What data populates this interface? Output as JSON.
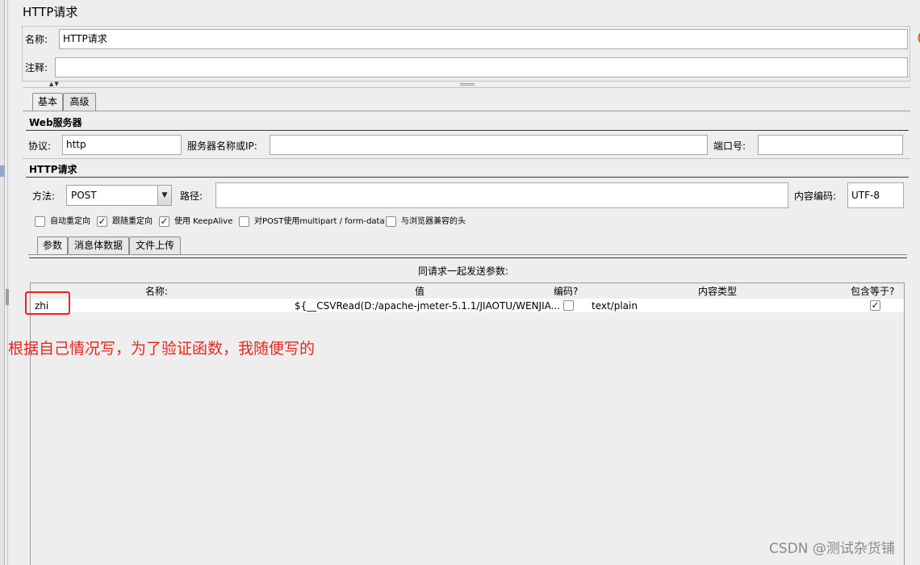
{
  "window": {
    "title": "HTTP请求"
  },
  "name_row": {
    "label": "名称:",
    "value": "HTTP请求"
  },
  "comment_row": {
    "label": "注释:",
    "value": ""
  },
  "tabs": [
    {
      "label": "基本"
    },
    {
      "label": "高级"
    }
  ],
  "web_server": {
    "title": "Web服务器",
    "protocol_label": "协议:",
    "protocol_value": "http",
    "server_label": "服务器名称或IP:",
    "server_value": "",
    "port_label": "端口号:",
    "port_value": ""
  },
  "http_request": {
    "title": "HTTP请求",
    "method_label": "方法:",
    "method_value": "POST",
    "path_label": "路径:",
    "path_value": "",
    "encoding_label": "内容编码:",
    "encoding_value": "UTF-8"
  },
  "options": [
    {
      "label": "自动重定向",
      "checked": false
    },
    {
      "label": "跟随重定向",
      "checked": true
    },
    {
      "label": "使用 KeepAlive",
      "checked": true
    },
    {
      "label": "对POST使用multipart / form-data",
      "checked": false
    },
    {
      "label": "与浏览器兼容的头",
      "checked": false
    }
  ],
  "sub_tabs": [
    {
      "label": "参数"
    },
    {
      "label": "消息体数据"
    },
    {
      "label": "文件上传"
    }
  ],
  "params": {
    "heading": "同请求一起发送参数:",
    "columns": {
      "name": "名称:",
      "value": "值",
      "encode": "编码?",
      "content_type": "内容类型",
      "include_equals": "包含等于?"
    },
    "rows": [
      {
        "name": "zhi",
        "value": "${__CSVRead(D:/apache-jmeter-5.1.1/JIAOTU/WENJIA...",
        "encode": false,
        "content_type": "text/plain",
        "include_equals": true
      }
    ]
  },
  "annotation": "根据自己情况写，为了验证函数，我随便写的",
  "watermark": "CSDN @测试杂货铺",
  "colors": {
    "annotation_red": "#e8261d",
    "background": "#eeeeee",
    "section_line": "#3b3b3b"
  }
}
